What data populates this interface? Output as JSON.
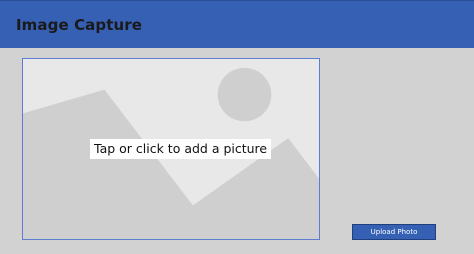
{
  "header": {
    "title": "Image Capture"
  },
  "image_capture": {
    "prompt": "Tap or click to add a picture",
    "placeholder_icon": "image-placeholder-icon"
  },
  "upload": {
    "button_label": "Upload Photo"
  },
  "colors": {
    "header": "#3560b4",
    "canvas": "#d2d2d2",
    "frame_border": "#5d7dd0",
    "placeholder_background": "#e8e8e8",
    "placeholder_shapes": "#cfcfcf"
  }
}
